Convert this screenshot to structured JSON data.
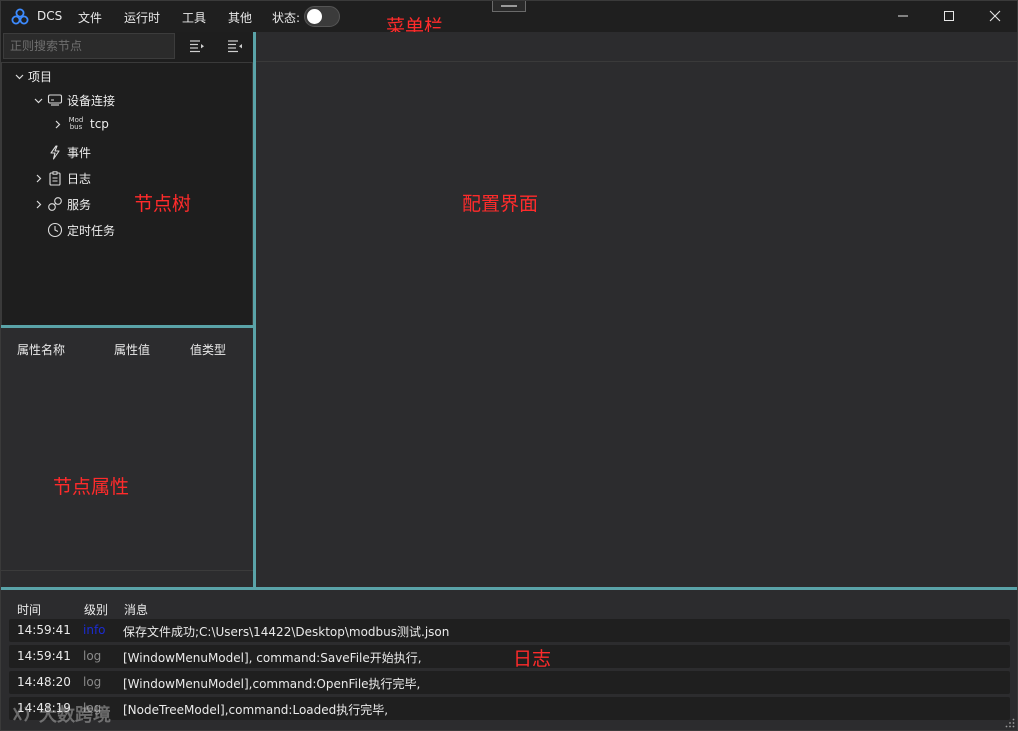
{
  "titlebar": {
    "app_name": "DCS",
    "menus": [
      "文件",
      "运行时",
      "工具",
      "其他"
    ],
    "status_label": "状态:",
    "status_on": false,
    "annotation": "菜单栏",
    "minimize": "—",
    "maximize": "☐",
    "close": "✕"
  },
  "search": {
    "placeholder": "正则搜索节点"
  },
  "tree": {
    "annotation": "节点树",
    "items": [
      {
        "label": "项目",
        "expanded": true,
        "icon": "chevron-down-icon"
      },
      {
        "label": "设备连接",
        "expanded": true,
        "icon": "device-connection-icon"
      },
      {
        "label": "tcp",
        "expanded": false,
        "icon": "modbus-icon",
        "icon_text_top": "Mod",
        "icon_text_bottom": "bus"
      },
      {
        "label": "事件",
        "icon": "lightning-icon"
      },
      {
        "label": "日志",
        "expanded": false,
        "icon": "log-file-icon"
      },
      {
        "label": "服务",
        "expanded": false,
        "icon": "service-link-icon"
      },
      {
        "label": "定时任务",
        "icon": "clock-icon"
      }
    ]
  },
  "properties": {
    "annotation": "节点属性",
    "columns": [
      "属性名称",
      "属性值",
      "值类型"
    ]
  },
  "config": {
    "annotation": "配置界面"
  },
  "log": {
    "annotation": "日志",
    "columns": [
      "时间",
      "级别",
      "消息"
    ],
    "rows": [
      {
        "time": "14:59:41",
        "level": "info",
        "message": "保存文件成功;C:\\Users\\14422\\Desktop\\modbus测试.json"
      },
      {
        "time": "14:59:41",
        "level": "log",
        "message": "[WindowMenuModel], command:SaveFile开始执行,"
      },
      {
        "time": "14:48:20",
        "level": "log",
        "message": "[WindowMenuModel],command:OpenFile执行完毕,"
      },
      {
        "time": "14:48:19",
        "level": "log",
        "message": "[NodeTreeModel],command:Loaded执行完毕,"
      }
    ]
  },
  "watermark": "大数跨境",
  "colors": {
    "accent_splitter": "#5aa3a8",
    "annotation_red": "#ff2b2b",
    "info_level": "#1b2bd1"
  }
}
